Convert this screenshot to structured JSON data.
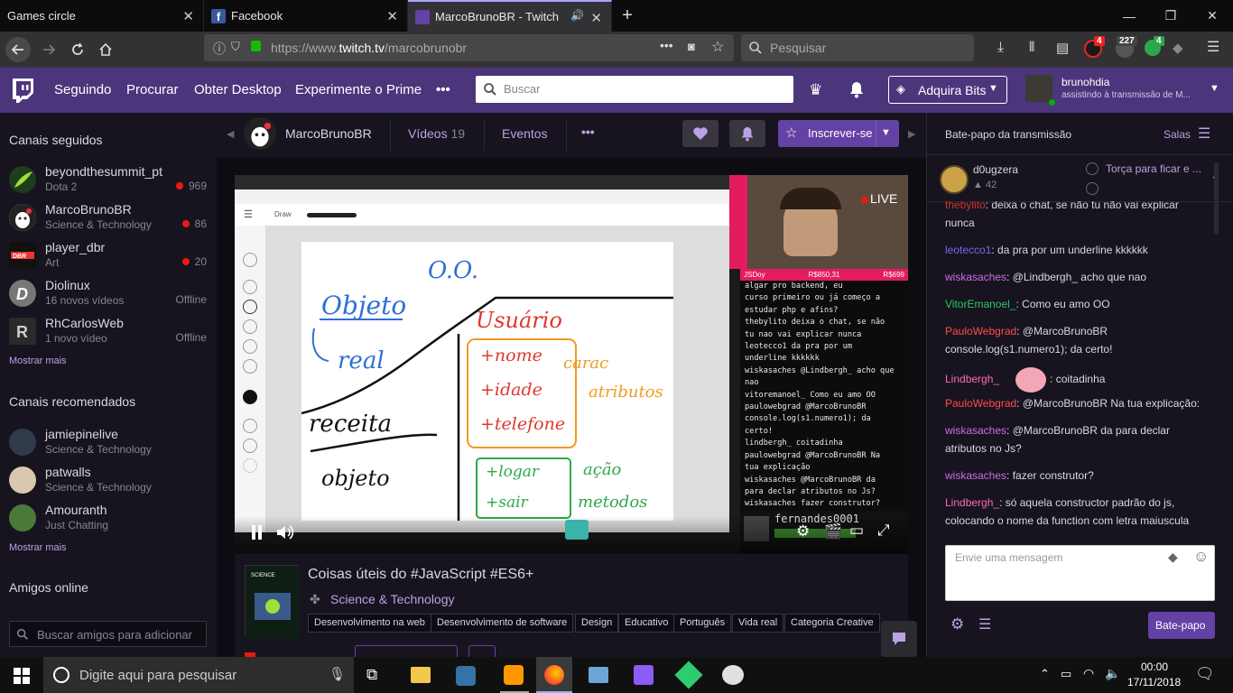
{
  "browser": {
    "tabs": [
      {
        "title": "Games circle"
      },
      {
        "title": "Facebook"
      },
      {
        "title": "MarcoBrunoBR - Twitch"
      }
    ],
    "url_prefix": "https://www.",
    "url_domain": "twitch.tv",
    "url_path": "/marcobrunobr",
    "url_more": "•••",
    "search_placeholder": "Pesquisar",
    "badges": {
      "ublock": "4",
      "counter": "227",
      "ext": "4"
    }
  },
  "twitch_nav": {
    "links": [
      "Seguindo",
      "Procurar",
      "Obter Desktop",
      "Experimente o Prime"
    ],
    "more": "•••",
    "search_placeholder": "Buscar",
    "bits_label": "Adquira Bits",
    "user_name": "brunohdia",
    "user_status": "assistindo à transmissão de M..."
  },
  "sidebar": {
    "followed_title": "Canais seguidos",
    "followed": [
      {
        "name": "beyondthesummit_pt",
        "game": "Dota 2",
        "viewers": "969",
        "live": true
      },
      {
        "name": "MarcoBrunoBR",
        "game": "Science & Technology",
        "viewers": "86",
        "live": true
      },
      {
        "name": "player_dbr",
        "game": "Art",
        "viewers": "20",
        "live": true
      },
      {
        "name": "Diolinux",
        "game": "16 novos vídeos",
        "viewers": "Offline",
        "live": false
      },
      {
        "name": "RhCarlosWeb",
        "game": "1 novo vídeo",
        "viewers": "Offline",
        "live": false
      }
    ],
    "followed_more": "Mostrar mais",
    "recommended_title": "Canais recomendados",
    "recommended": [
      {
        "name": "jamiepinelive",
        "game": "Science & Technology"
      },
      {
        "name": "patwalls",
        "game": "Science & Technology"
      },
      {
        "name": "Amouranth",
        "game": "Just Chatting"
      }
    ],
    "recommended_more": "Mostrar mais",
    "friends_title": "Amigos online",
    "friends_search_placeholder": "Buscar amigos para adicionar"
  },
  "channel": {
    "name": "MarcoBrunoBR",
    "videos_label": "Vídeos",
    "videos_count": "19",
    "events_label": "Eventos",
    "more": "•••",
    "subscribe_label": "Inscrever-se"
  },
  "video": {
    "live_label": "LIVE",
    "overlay_user": "fernandes0001",
    "overlay_footer": [
      "JSDoy",
      "R$850,31",
      "R$699"
    ],
    "board_texts": [
      "O.O.",
      "Objeto",
      "real",
      "receita",
      "objeto",
      "Usuário",
      "+nome",
      "+idade",
      "+telefone",
      "carac",
      "atributos",
      "+logar",
      "+sair",
      "ação",
      "metodos"
    ],
    "draw_label": "Draw",
    "mini_chat": [
      "algar pro backend, eu",
      "curso primeiro ou já começo a",
      "estudar php e afins?",
      "thebylito deixa o chat, se não",
      "tu nao vai explicar nunca",
      "leotecco1 da pra por um",
      "underline kkkkkk",
      "wiskasaches @Lindbergh_ acho que",
      "nao",
      "vitoremanoel_ Como eu amo OO",
      "paulowebgrad @MarcoBrunoBR",
      "console.log(s1.numero1); da",
      "certo!",
      "lindbergh_ coitadinha",
      "paulowebgrad @MarcoBrunoBR Na",
      "tua explicação",
      "wiskasaches @MarcoBrunoBR da",
      "para declar atributos no Js?",
      "wiskasaches fazer construtor?"
    ]
  },
  "stream_info": {
    "title": "Coisas úteis do #JavaScript #ES6+",
    "category": "Science & Technology",
    "tags": [
      "Desenvolvimento na web",
      "Desenvolvimento de software",
      "Design",
      "Educativo",
      "Português",
      "Vida real",
      "Categoria Creative"
    ]
  },
  "chat": {
    "header": "Bate-papo da transmissão",
    "rooms_label": "Salas",
    "top_user": "d0ugzera",
    "top_points": "42",
    "poll_label": "Torça para ficar e ...",
    "messages": [
      {
        "user": "thebylito",
        "color": "#d2322d",
        "text": ": deixa o chat, se não tu não vai explicar nunca"
      },
      {
        "user": "leotecco1",
        "color": "#6e6ef0",
        "text": ": da pra por um underline kkkkkk"
      },
      {
        "user": "wiskasaches",
        "color": "#cc6ee8",
        "text": ": @Lindbergh_ acho que nao"
      },
      {
        "user": "VitorEmanoel_",
        "color": "#2ec26b",
        "text": ": Como eu amo OO"
      },
      {
        "user": "PauloWebgrad",
        "color": "#ff4d4d",
        "text": ": @MarcoBrunoBR console.log(s1.numero1); da certo!"
      },
      {
        "user": "Lindbergh_",
        "color": "#ff69b4",
        "text": ":  coitadinha"
      },
      {
        "user": "PauloWebgrad",
        "color": "#ff4d4d",
        "text": ": @MarcoBrunoBR Na tua explicação:"
      },
      {
        "user": "wiskasaches",
        "color": "#cc6ee8",
        "text": ": @MarcoBrunoBR da para declar atributos no Js?"
      },
      {
        "user": "wiskasaches",
        "color": "#cc6ee8",
        "text": ": fazer construtor?"
      },
      {
        "user": "Lindbergh_",
        "color": "#ff69b4",
        "text": ": só aquela constructor padrão do js, colocando o nome da function com letra maiuscula"
      }
    ],
    "input_placeholder": "Envie uma mensagem",
    "send_label": "Bate-papo"
  },
  "taskbar": {
    "search_placeholder": "Digite aqui para pesquisar",
    "time": "00:00",
    "date": "17/11/2018"
  },
  "colors": {
    "twitch_purple": "#4b367c",
    "accent": "#6441a4",
    "live_red": "#e91916"
  }
}
